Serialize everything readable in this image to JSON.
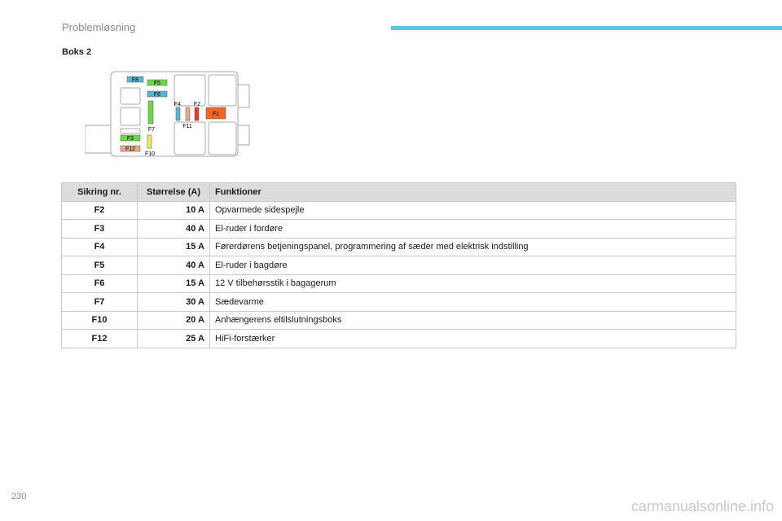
{
  "header": {
    "section": "Problemløsning",
    "accent_color": "#5ec6e0"
  },
  "box_title": "Boks 2",
  "diagram": {
    "fuses": [
      {
        "id": "F8",
        "color": "#5bb5d4"
      },
      {
        "id": "F5",
        "color": "#6fd64a"
      },
      {
        "id": "F6",
        "color": "#5bb5d4"
      },
      {
        "id": "F4",
        "color": "#5bb5d4"
      },
      {
        "id": "F2",
        "color": "#e53935"
      },
      {
        "id": "F1",
        "color": "#f26522"
      },
      {
        "id": "F11",
        "color": "#e8a98d"
      },
      {
        "id": "F7",
        "color": "#6fd64a"
      },
      {
        "id": "F3",
        "color": "#6fd64a"
      },
      {
        "id": "F12",
        "color": "#e8a98d"
      },
      {
        "id": "F10",
        "color": "#f2ea5b"
      }
    ]
  },
  "table": {
    "headers": [
      "Sikring nr.",
      "Størrelse (A)",
      "Funktioner"
    ],
    "rows": [
      [
        "F2",
        "10 A",
        "Opvarmede sidespejle"
      ],
      [
        "F3",
        "40 A",
        "El-ruder i fordøre"
      ],
      [
        "F4",
        "15 A",
        "Førerdørens betjeningspanel, programmering af sæder med elektrisk indstilling"
      ],
      [
        "F5",
        "40 A",
        "El-ruder i bagdøre"
      ],
      [
        "F6",
        "15 A",
        "12 V tilbehørsstik i bagagerum"
      ],
      [
        "F7",
        "30 A",
        "Sædevarme"
      ],
      [
        "F10",
        "20 A",
        "Anhængerens eltilslutningsboks"
      ],
      [
        "F12",
        "25 A",
        "HiFi-forstærker"
      ]
    ]
  },
  "footer": {
    "page_number": "230",
    "watermark": "carmanualsonline.info"
  }
}
